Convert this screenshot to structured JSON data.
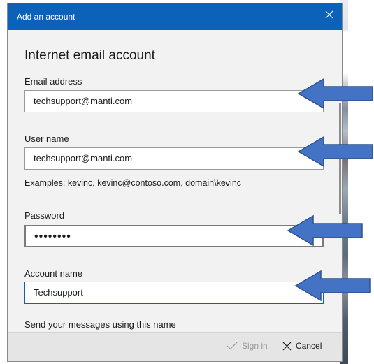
{
  "window": {
    "title": "Add an account"
  },
  "page": {
    "heading": "Internet email account"
  },
  "fields": {
    "email": {
      "label": "Email address",
      "value": "techsupport@manti.com"
    },
    "username": {
      "label": "User name",
      "value": "techsupport@manti.com",
      "hint": "Examples: kevinc, kevinc@contoso.com, domain\\kevinc"
    },
    "password": {
      "label": "Password",
      "value": "••••••••"
    },
    "account_name": {
      "label": "Account name",
      "value": "Techsupport"
    },
    "send_name": {
      "label": "Send your messages using this name",
      "value": ""
    }
  },
  "footer": {
    "signin_label": "Sign in",
    "cancel_label": "Cancel"
  },
  "colors": {
    "titlebar": "#0b62b8",
    "arrow_fill": "#4472c4",
    "arrow_stroke": "#2f528f"
  },
  "icons": {
    "close": "close-icon",
    "signin": "checkmark-icon",
    "cancel": "close-icon"
  }
}
